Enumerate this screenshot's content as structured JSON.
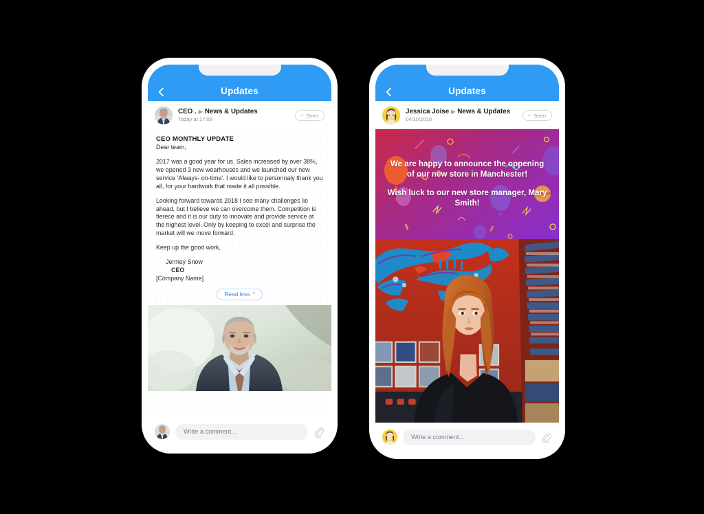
{
  "colors": {
    "nav_blue": "#2F9BF5",
    "banner_gradient_from": "#C42A4E",
    "banner_gradient_to": "#8B2FC9",
    "link_blue": "#3D8EE0",
    "page_background": "#000000"
  },
  "phones": [
    {
      "id": "ceo",
      "nav": {
        "title": "Updates",
        "back_icon": "chevron-left-icon"
      },
      "post": {
        "author": "CEO .",
        "channel_arrow": "play-triangle-icon",
        "channel": "News & Updates",
        "timestamp": "Today at 17:09",
        "seen_label": "Seen",
        "seen_check": "check-icon",
        "avatar_name": "avatar-ceo"
      },
      "article": {
        "title": "CEO MONTHLY UPDATE",
        "greeting": "Dear team,",
        "paragraphs": [
          "2017 was a good year for us. Sales increased by over 38%, we opened 3 new wearhouses and we launched our new service 'Always- on-time'. I would like to personnaly thank you all, for your hardwork that made it all possible.",
          "Looking forward towards 2018 I see many challenges lie ahead, but I believe we can overcome them. Competition is fierece and it is our duty to innovate and provide service at the highest level. Only by keeping to excel and surprise the market will we move forward.",
          "Keep up the good work,"
        ],
        "signature_name": "Jermey Snow",
        "signature_role": "CEO",
        "signature_company": "[Company Name]",
        "read_less_label": "Read less",
        "read_less_caret": "chevron-up-icon"
      },
      "media": {
        "name": "ceo-portrait-photo",
        "description": "Portrait of grey-haired man in dark suit with patterned tie"
      },
      "comment": {
        "placeholder": "Write a comment...",
        "value": "",
        "attach_icon": "paperclip-icon",
        "avatar_name": "avatar-ceo-small"
      }
    },
    {
      "id": "store",
      "nav": {
        "title": "Updates",
        "back_icon": "chevron-left-icon"
      },
      "post": {
        "author": "Jessica Joise",
        "channel_arrow": "play-triangle-icon",
        "channel": "News & Updates",
        "timestamp": "04/10/2019",
        "seen_label": "Seen",
        "seen_check": "check-icon",
        "avatar_name": "avatar-jessica"
      },
      "banner": {
        "name": "store-announcement-banner",
        "line1": "We are happy to announce the oppening of our new store in Manchester!",
        "line2": "Wish luck to our new store manager, Mary Smith!"
      },
      "media": {
        "name": "record-shop-photo",
        "description": "Red-haired woman in black top standing in a record shop with blue dragon mural"
      },
      "comment": {
        "placeholder": "Write a comment...",
        "value": "",
        "attach_icon": "paperclip-icon",
        "avatar_name": "avatar-jessica-small"
      }
    }
  ]
}
